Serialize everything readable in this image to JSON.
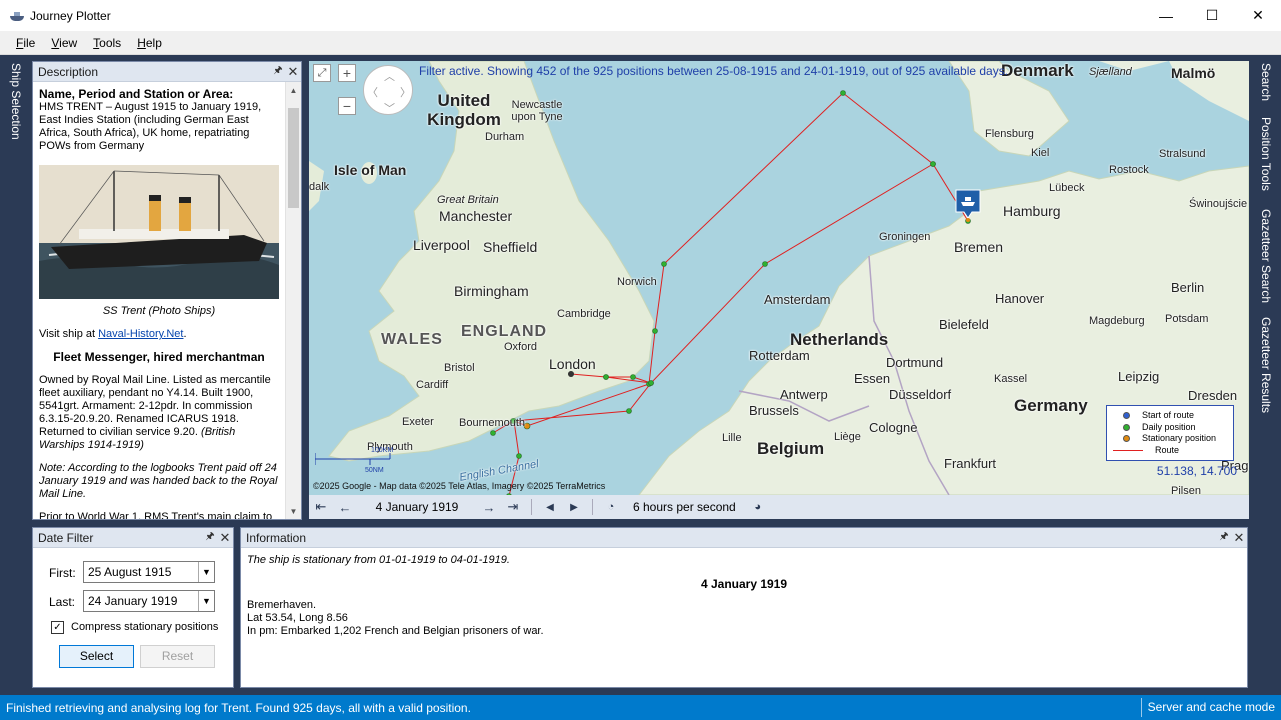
{
  "window": {
    "title": "Journey Plotter",
    "minimize": "—",
    "maximize": "☐",
    "close": "✕"
  },
  "menu": [
    "File",
    "View",
    "Tools",
    "Help"
  ],
  "left_tabs": [
    "Ship Selection"
  ],
  "right_tabs": [
    "Search",
    "Position Tools",
    "Gazetteer Search",
    "Gazetteer Results"
  ],
  "description": {
    "header": "Description",
    "name_heading": "Name, Period and Station or Area:",
    "name_text": "HMS TRENT – August 1915 to January 1919, East Indies Station (including German East Africa, South Africa), UK home, repatriating POWs from Germany",
    "image_caption": "SS Trent (Photo Ships)",
    "visit_prefix": "Visit ship at ",
    "visit_link": "Naval-History.Net",
    "visit_suffix": ".",
    "role_heading": "Fleet Messenger, hired merchantman",
    "owned_text": "Owned by Royal Mail Line. Listed as mercantile fleet auxiliary, pendant no Y4.14. Built 1900, 5541grt. Armament: 2-12pdr. In commission 6.3.15-20.9.20. Renamed ICARUS 1918. Returned to civilian service 9.20. ",
    "owned_source": "(British Warships 1914-1919)",
    "note_text": "Note: According to the logbooks Trent paid off 24 January 1919 and was handed back to the Royal Mail Line.",
    "prior_text": "Prior to World War 1, RMS Trent's main claim to"
  },
  "map": {
    "filter_message": "Filter active. Showing 452 of the 925 positions  between 25-08-1915 and 24-01-1919, out of 925 available days.",
    "copyright": "©2025 Google - Map data ©2025 Tele Atlas, Imagery ©2025 TerraMetrics",
    "coords": "51.138, 14.700",
    "scale_km": "100KM",
    "scale_nm": "50NM",
    "labels": {
      "denmark": "Denmark",
      "sjaelland": "Sjælland",
      "malmo": "Malmö",
      "united_kingdom": "United Kingdom",
      "newcastle": "Newcastle upon Tyne",
      "durham": "Durham",
      "isle_of_man": "Isle of Man",
      "dalk": "dalk",
      "great_britain": "Great Britain",
      "manchester": "Manchester",
      "liverpool": "Liverpool",
      "sheffield": "Sheffield",
      "birmingham": "Birmingham",
      "norwich": "Norwich",
      "cambridge": "Cambridge",
      "wales": "WALES",
      "england": "ENGLAND",
      "oxford": "Oxford",
      "london": "London",
      "bristol": "Bristol",
      "cardiff": "Cardiff",
      "exeter": "Exeter",
      "bournemouth": "Bournemouth",
      "plymouth": "Plymouth",
      "english_channel": "English Channel",
      "flensburg": "Flensburg",
      "kiel": "Kiel",
      "stralsund": "Stralsund",
      "rostock": "Rostock",
      "lubeck": "Lübeck",
      "swinoujscie": "Świnoujście",
      "hamburg": "Hamburg",
      "groningen": "Groningen",
      "bremen": "Bremen",
      "amsterdam": "Amsterdam",
      "netherlands": "Netherlands",
      "hanover": "Hanover",
      "berlin": "Berlin",
      "bielefeld": "Bielefeld",
      "magdeburg": "Magdeburg",
      "potsdam": "Potsdam",
      "rotterdam": "Rotterdam",
      "dortmund": "Dortmund",
      "essen": "Essen",
      "kassel": "Kassel",
      "leipzig": "Leipzig",
      "dresden": "Dresden",
      "antwerp": "Antwerp",
      "dusseldorf": "Düsseldorf",
      "brussels": "Brussels",
      "germany": "Germany",
      "cologne": "Cologne",
      "lille": "Lille",
      "belgium": "Belgium",
      "liege": "Liège",
      "frankfurt": "Frankfurt",
      "prague": "Prague",
      "pilsen": "Pilsen"
    },
    "legend": {
      "start": "Start of route",
      "daily": "Daily position",
      "stationary": "Stationary position",
      "route": "Route"
    },
    "colors": {
      "route": "#e02020",
      "start": "#3060d0",
      "daily": "#30b030",
      "stationary": "#e08a10",
      "land": "#e9efe0",
      "sea": "#aad3df"
    }
  },
  "playback": {
    "date": "4 January 1919",
    "speed": "6 hours per second"
  },
  "date_filter": {
    "header": "Date Filter",
    "first_label": "First:",
    "first_value": "25 August 1915",
    "last_label": "Last:",
    "last_value": "24 January 1919",
    "compress_label": "Compress stationary positions",
    "compress_checked": true,
    "select_label": "Select",
    "reset_label": "Reset"
  },
  "information": {
    "header": "Information",
    "stationary": "The ship is stationary from 01-01-1919 to 04-01-1919.",
    "date": "4 January 1919",
    "place": "Bremerhaven.",
    "latlong": "Lat 53.54, Long 8.56",
    "event": "In pm: Embarked 1,202 French and Belgian prisoners of war."
  },
  "status": {
    "message": "Finished retrieving and analysing log for Trent. Found 925 days, all with a valid position.",
    "mode": "Server and cache mode"
  }
}
